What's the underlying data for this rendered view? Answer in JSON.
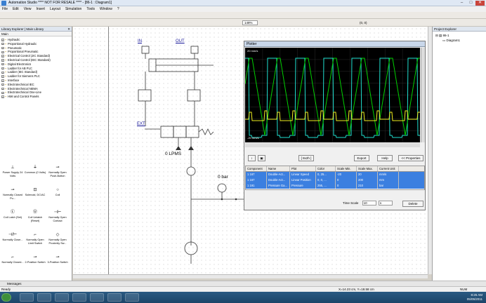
{
  "window": {
    "title": "Automation Studio  **** NOT FOR RESALE ****  - [86-1 : Diagram1]",
    "minimize": "–",
    "maximize": "□",
    "close": "✕"
  },
  "menu": [
    "File",
    "Edit",
    "View",
    "Insert",
    "Layout",
    "Simulation",
    "Tools",
    "Window",
    "?"
  ],
  "toolbar": {
    "zoom": "148%",
    "coords": "(0, 0)"
  },
  "library": {
    "title": "Library Explorer | Main Library",
    "tab": "Main",
    "tree": [
      "Hydraulic",
      "Proportional Hydraulic",
      "Pneumatic",
      "Proportional Pneumatic",
      "Electrical Control (JIC Standard)",
      "Electrical Control (IEC Standard)",
      "Digital Electronics",
      "Ladder for AB PLC",
      "Ladder (IEC Standard)",
      "Ladder for Siemens PLC",
      "Interface",
      "Electrotechnical IEC",
      "Electrotechnical NEMA",
      "Electrotechnical One-Line",
      "HMI and Control Panels"
    ],
    "components": [
      {
        "label": "Power Supply 24 Volts",
        "sym": "⊥"
      },
      {
        "label": "Common (0 Volts)",
        "sym": "⏚"
      },
      {
        "label": "Normally Open Push-Button",
        "sym": "⊸"
      },
      {
        "label": "Normally Closed Pu...",
        "sym": "⊸"
      },
      {
        "label": "Solenoid, DC/AC",
        "sym": "⊡"
      },
      {
        "label": "Coil",
        "sym": "○"
      },
      {
        "label": "Coil Latch (Set)",
        "sym": "Ⓛ"
      },
      {
        "label": "Coil Unlatch (Reset)",
        "sym": "Ⓤ"
      },
      {
        "label": "Normally Open Contact",
        "sym": "⊣⊢"
      },
      {
        "label": "Normally Close...",
        "sym": "⊣/⊢"
      },
      {
        "label": "Normally Open Limit Switch",
        "sym": "⌐"
      },
      {
        "label": "Normally Open Proximity Sw...",
        "sym": "◇"
      },
      {
        "label": "Normally Closed...",
        "sym": "⌐"
      },
      {
        "label": "2-Position Switch",
        "sym": "⊸"
      },
      {
        "label": "3-Position Switch",
        "sym": "⊸"
      }
    ]
  },
  "diagram": {
    "in_label": "IN",
    "out_label": "OUT",
    "ext_label": "EXT",
    "flow_value": "0 LPMS",
    "pressure_value": "0 bar"
  },
  "plotter": {
    "title": "Plotter",
    "top_value": "20 mm/s",
    "bottom_value": "-20 mm/s",
    "zoom_label": "[ 8x2h ]",
    "buttons": {
      "export": "Export",
      "help": "Help",
      "properties": "<< Properties",
      "delete": "Delete"
    },
    "headers": [
      "Component",
      "Name",
      "Plot",
      "Color",
      "Scale Min.",
      "Scale Max.",
      "Current Unit"
    ],
    "rows": [
      [
        "1 167",
        "Double-Act...",
        "Linear Speed",
        "0, 25...",
        "-20",
        "20",
        "mm/s"
      ],
      [
        "1 167",
        "Double-Act...",
        "Linear Position",
        "0, 0, ...",
        "0",
        "200",
        "mm"
      ],
      [
        "1 191",
        "Pressure Ga...",
        "Pressure",
        "255, ...",
        "0",
        "210",
        "bar"
      ]
    ],
    "time_scale_label": "Time Scale",
    "time_scale_value": "10",
    "time_scale_unit": "s"
  },
  "project": {
    "title": "Project Explorer",
    "project": "86-1",
    "diagram": "Diagram1"
  },
  "messages": {
    "label": "Messages"
  },
  "status": {
    "left": "Ready",
    "coords": "X=14.23 cm, Y=18.58 cm",
    "num": "NUM"
  },
  "clock": {
    "time": "8:25 AM",
    "date": "05/05/2011"
  },
  "colors": {
    "plot_bg": "#000000",
    "speed": "#20e0d0",
    "position": "#00d000",
    "pressure": "#f0f020",
    "accent": "#3b7fe0"
  }
}
